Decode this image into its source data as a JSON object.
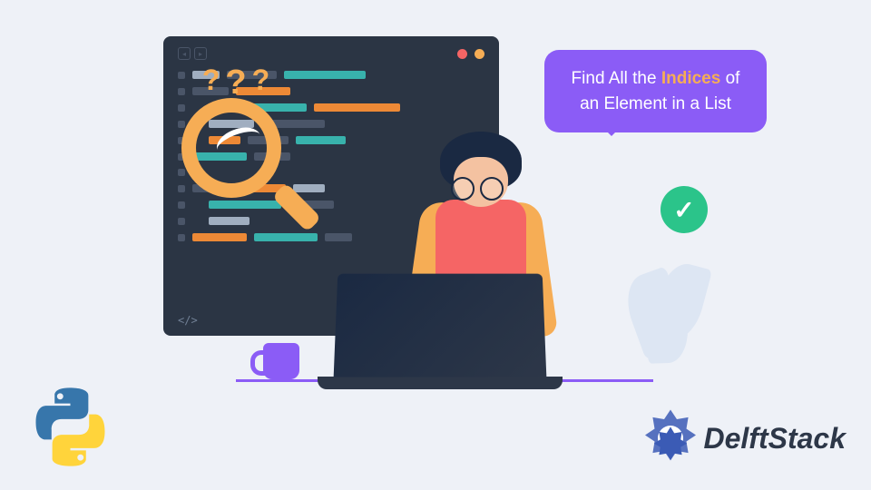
{
  "bubble": {
    "prefix": "Find All the ",
    "highlight": "Indices",
    "suffix": " of an Element in a List"
  },
  "brand": {
    "name": "DelftStack"
  },
  "colors": {
    "bg": "#eef1f7",
    "purple": "#8b5cf6",
    "orange": "#f6ad55",
    "teal": "#38b2ac",
    "green": "#2bc48a",
    "navy": "#1a2942"
  }
}
